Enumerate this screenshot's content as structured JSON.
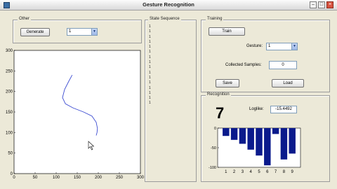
{
  "window": {
    "title": "Gesture Recognition"
  },
  "other": {
    "title": "Other",
    "generate_label": "Generate",
    "select_value": "1"
  },
  "state_sequence": {
    "title": "State Sequence",
    "values": [
      "1",
      "1",
      "1",
      "1",
      "1",
      "1",
      "1",
      "1",
      "1",
      "1",
      "1",
      "1",
      "1",
      "1",
      "1",
      "1"
    ]
  },
  "training": {
    "title": "Training",
    "train_label": "Train",
    "gesture_label": "Gesture:",
    "gesture_value": "1",
    "collected_label": "Collected Samples:",
    "collected_value": "0",
    "save_label": "Save",
    "load_label": "Load"
  },
  "recognition": {
    "title": "Recognition",
    "result": "7",
    "loglike_label": "Loglike:",
    "loglike_value": "-15.4492"
  },
  "drawing_plot": {
    "xticks": [
      "0",
      "50",
      "100",
      "150",
      "200",
      "250",
      "300"
    ],
    "yticks": [
      "300",
      "250",
      "200",
      "150",
      "100",
      "50",
      "0"
    ],
    "xlim": [
      0,
      300
    ],
    "ylim": [
      0,
      300
    ],
    "stroke_color": "#3b4bd1",
    "stroke": [
      [
        138,
        240
      ],
      [
        130,
        225
      ],
      [
        120,
        205
      ],
      [
        115,
        185
      ],
      [
        122,
        170
      ],
      [
        140,
        160
      ],
      [
        165,
        150
      ],
      [
        185,
        140
      ],
      [
        195,
        125
      ],
      [
        198,
        110
      ],
      [
        197,
        100
      ],
      [
        195,
        93
      ]
    ]
  },
  "chart_data": {
    "type": "bar",
    "categories": [
      "1",
      "2",
      "3",
      "4",
      "5",
      "6",
      "7",
      "8",
      "9"
    ],
    "values": [
      -20,
      -30,
      -40,
      -55,
      -70,
      -95,
      -15,
      -80,
      -65
    ],
    "ylim": [
      -100,
      0
    ],
    "yticks": [
      "0",
      "-50",
      "-100"
    ],
    "bar_color": "#0a1a8c"
  }
}
